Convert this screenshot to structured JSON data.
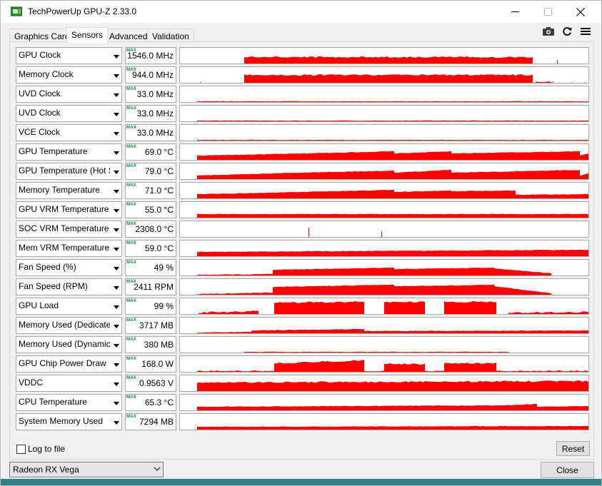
{
  "window": {
    "title": "TechPowerUp GPU-Z 2.33.0"
  },
  "tabs": [
    {
      "label": "Graphics Card",
      "active": false
    },
    {
      "label": "Sensors",
      "active": true
    },
    {
      "label": "Advanced",
      "active": false
    },
    {
      "label": "Validation",
      "active": false
    }
  ],
  "toolbar": {
    "icons": [
      "camera-icon",
      "refresh-icon",
      "menu-icon"
    ]
  },
  "sensor_max_badge": "MAX",
  "sensors": [
    {
      "name": "GPU Clock",
      "value": "1546.0 MHz"
    },
    {
      "name": "Memory Clock",
      "value": "944.0 MHz"
    },
    {
      "name": "UVD Clock",
      "value": "33.0 MHz"
    },
    {
      "name": "UVD Clock",
      "value": "33.0 MHz"
    },
    {
      "name": "VCE Clock",
      "value": "33.0 MHz"
    },
    {
      "name": "GPU Temperature",
      "value": "69.0 °C"
    },
    {
      "name": "GPU Temperature (Hot Spot)",
      "value": "79.0 °C"
    },
    {
      "name": "Memory Temperature",
      "value": "71.0 °C"
    },
    {
      "name": "GPU VRM Temperature",
      "value": "55.0 °C"
    },
    {
      "name": "SOC VRM Temperature",
      "value": "2308.0 °C"
    },
    {
      "name": "Mem VRM Temperature",
      "value": "59.0 °C"
    },
    {
      "name": "Fan Speed (%)",
      "value": "49 %"
    },
    {
      "name": "Fan Speed (RPM)",
      "value": "2411 RPM"
    },
    {
      "name": "GPU Load",
      "value": "99 %"
    },
    {
      "name": "Memory Used (Dedicated)",
      "value": "3717 MB"
    },
    {
      "name": "Memory Used (Dynamic)",
      "value": "380 MB"
    },
    {
      "name": "GPU Chip Power Draw",
      "value": "168.0 W"
    },
    {
      "name": "VDDC",
      "value": "0.9563 V"
    },
    {
      "name": "CPU Temperature",
      "value": "65.3 °C"
    },
    {
      "name": "System Memory Used",
      "value": "7294 MB"
    }
  ],
  "footer": {
    "log_label": "Log to file",
    "log_checked": false,
    "reset_label": "Reset",
    "gpu_select": "Radeon RX Vega",
    "close_label": "Close"
  },
  "colors": {
    "graph": "#ff0000"
  }
}
